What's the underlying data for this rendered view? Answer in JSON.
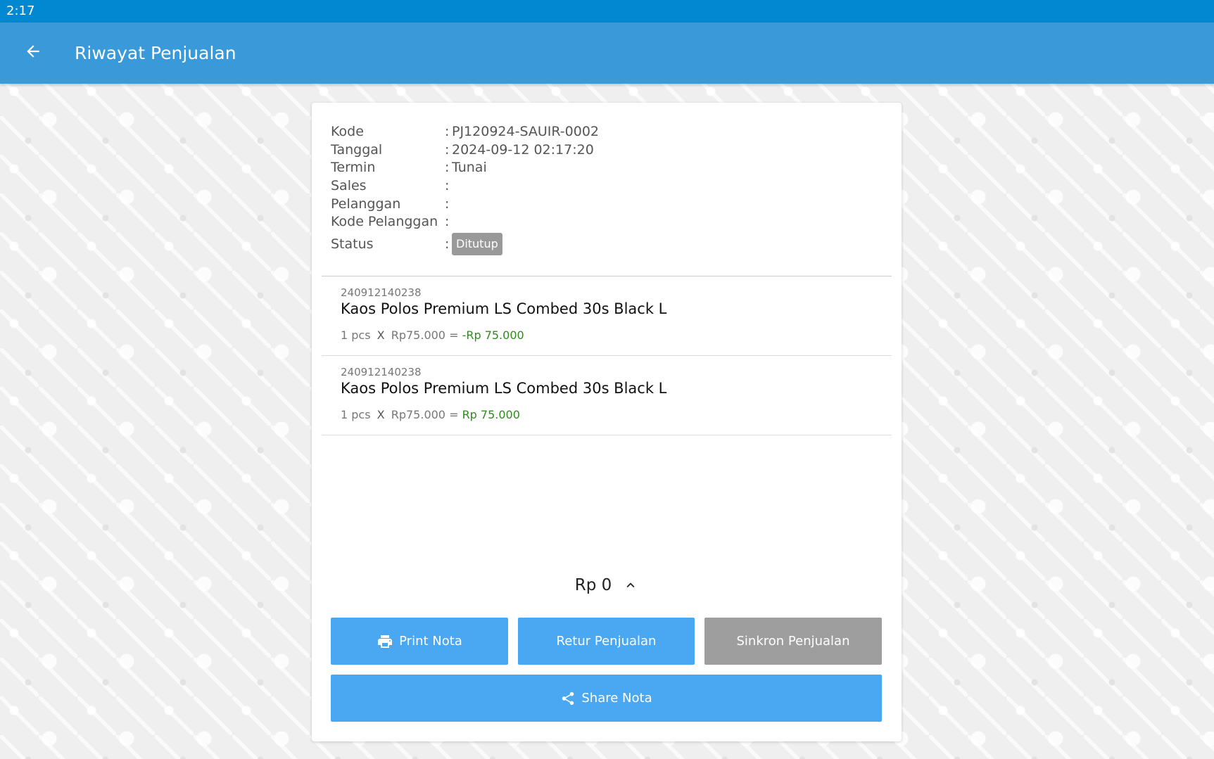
{
  "status_bar": {
    "time": "2:17"
  },
  "app_bar": {
    "title": "Riwayat Penjualan",
    "back_icon": "arrow-left-icon"
  },
  "info": {
    "rows": [
      {
        "label": "Kode",
        "colon": ":",
        "value": "PJ120924-SAUIR-0002"
      },
      {
        "label": "Tanggal",
        "colon": ":",
        "value": "2024-09-12 02:17:20"
      },
      {
        "label": "Termin",
        "colon": ":",
        "value": "Tunai"
      },
      {
        "label": "Sales",
        "colon": ":",
        "value": ""
      },
      {
        "label": "Pelanggan",
        "colon": ":",
        "value": ""
      },
      {
        "label": "Kode Pelanggan",
        "colon": ":",
        "value": ""
      }
    ],
    "status": {
      "label": "Status",
      "colon": ":",
      "badge": "Ditutup",
      "badge_color": "#999999"
    }
  },
  "items": [
    {
      "code": "240912140238",
      "name": "Kaos Polos Premium LS Combed 30s Black L",
      "qty": "1 pcs",
      "times": "X",
      "price": "Rp75.000 =",
      "amount": "-Rp 75.000"
    },
    {
      "code": "240912140238",
      "name": "Kaos Polos Premium LS Combed 30s Black L",
      "qty": "1 pcs",
      "times": "X",
      "price": "Rp75.000 =",
      "amount": "Rp 75.000"
    }
  ],
  "total": {
    "value": "Rp 0",
    "toggle_icon": "chevron-up-icon"
  },
  "buttons": {
    "print": {
      "label": "Print Nota",
      "icon": "printer-icon"
    },
    "retur": {
      "label": "Retur Penjualan"
    },
    "sinkron": {
      "label": "Sinkron Penjualan"
    },
    "share": {
      "label": "Share Nota",
      "icon": "share-icon"
    }
  },
  "colors": {
    "status_bar": "#0288d1",
    "app_bar": "#3a9ad9",
    "primary_button": "#4aa8f2",
    "disabled_button": "#9e9e9e",
    "amount_green": "#2e8b1e"
  }
}
